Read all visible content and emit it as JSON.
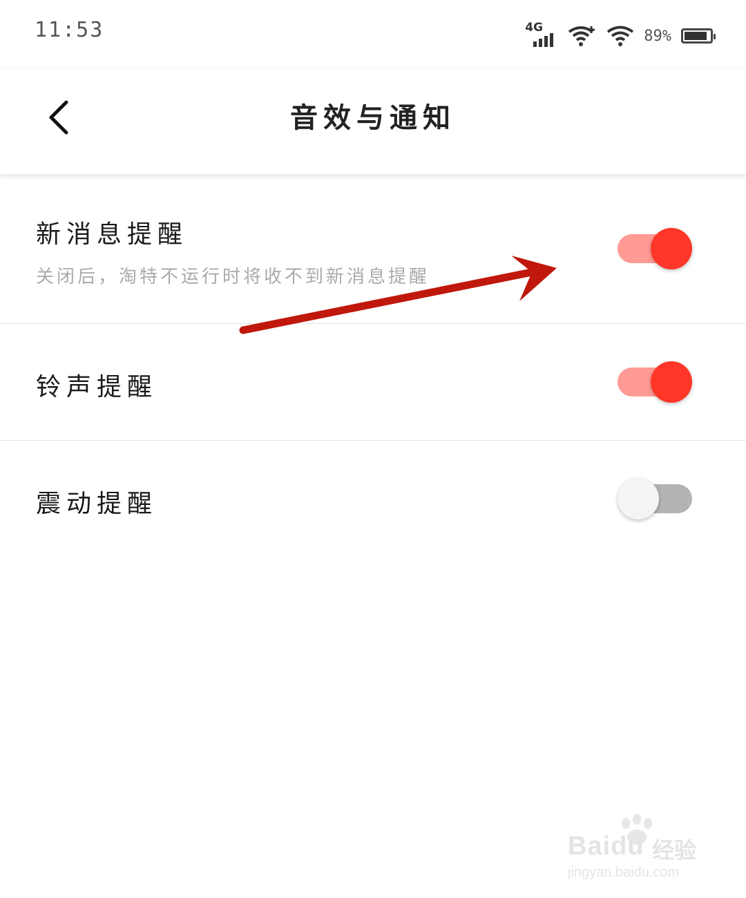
{
  "status_bar": {
    "time": "11:53",
    "network": "4G",
    "battery_percent": "89%",
    "battery_level": 0.89,
    "icons": [
      "signal-4g-icon",
      "wifi-plus-icon",
      "wifi-icon",
      "battery-icon"
    ]
  },
  "header": {
    "title": "音效与通知",
    "back_icon": "chevron-left-icon"
  },
  "settings": [
    {
      "title": "新消息提醒",
      "subtitle": "关闭后，淘特不运行时将收不到新消息提醒",
      "enabled": true
    },
    {
      "title": "铃声提醒",
      "enabled": true
    },
    {
      "title": "震动提醒",
      "enabled": false
    }
  ],
  "colors": {
    "toggle_on_knob": "#ff3628",
    "toggle_on_track": "#ff9a94",
    "toggle_off_knob": "#f4f4f4",
    "toggle_off_track": "#b3b3b3",
    "annotation_arrow": "#c0180c"
  },
  "watermark": {
    "brand": "Bai",
    "brand_suffix": "du",
    "brand_cn": "经验",
    "url": "jingyan.baidu.com"
  }
}
